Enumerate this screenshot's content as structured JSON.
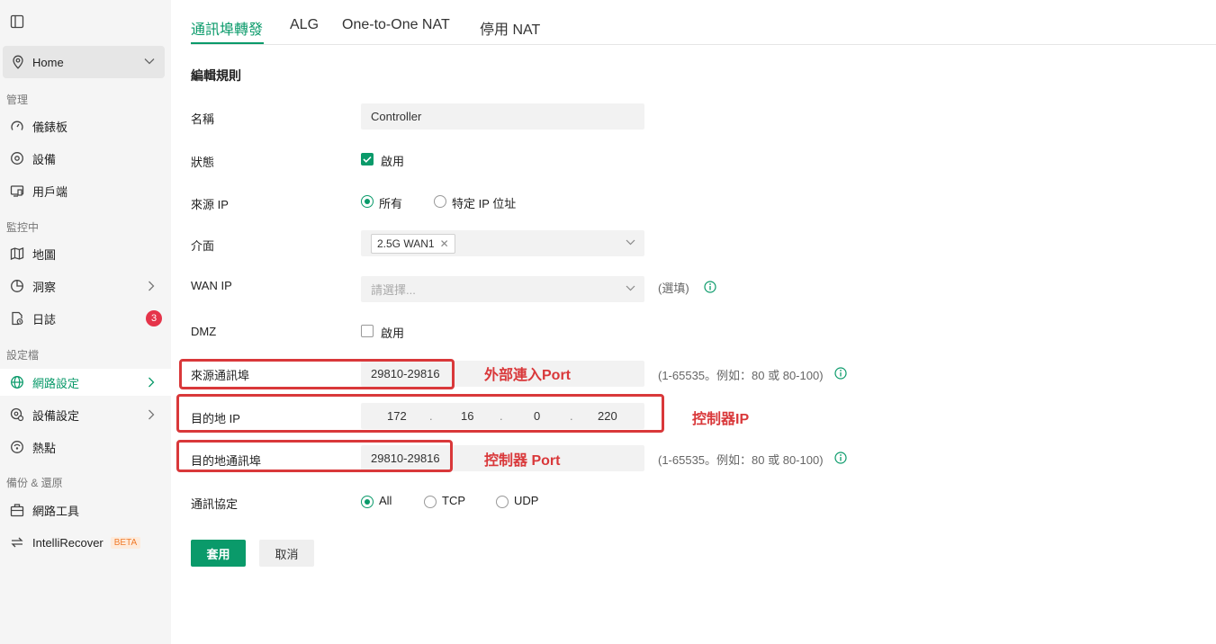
{
  "sidebar": {
    "site": "Home",
    "sections": {
      "manage": "管理",
      "monitor": "監控中",
      "profiles": "設定檔",
      "backup": "備份 & 還原"
    },
    "items": {
      "dashboard": "儀錶板",
      "devices": "設備",
      "clients": "用戶端",
      "map": "地圖",
      "insights": "洞察",
      "logs": "日誌",
      "logs_badge": "3",
      "network_settings": "網路設定",
      "device_settings": "設備設定",
      "hotspot": "熱點",
      "network_tools": "網路工具",
      "intellirecover": "IntelliRecover",
      "beta": "BETA"
    }
  },
  "tabs": [
    "通訊埠轉發",
    "ALG",
    "One-to-One NAT",
    "停用 NAT"
  ],
  "form": {
    "title": "編輯規則",
    "name_label": "名稱",
    "name_value": "Controller",
    "status_label": "狀態",
    "status_option": "啟用",
    "source_ip_label": "來源 IP",
    "source_ip_all": "所有",
    "source_ip_specific": "特定 IP 位址",
    "interface_label": "介面",
    "interface_chip": "2.5G WAN1",
    "wan_ip_label": "WAN IP",
    "wan_ip_placeholder": "請選擇...",
    "wan_ip_hint": "(選填)",
    "dmz_label": "DMZ",
    "dmz_option": "啟用",
    "source_port_label": "來源通訊埠",
    "source_port_value": "29810-29816",
    "port_hint": "(1-65535。例如：80 或 80-100)",
    "dest_ip_label": "目的地 IP",
    "dest_ip": [
      "172",
      "16",
      "0",
      "220"
    ],
    "dest_port_label": "目的地通訊埠",
    "dest_port_value": "29810-29816",
    "protocol_label": "通訊協定",
    "protocols": [
      "All",
      "TCP",
      "UDP"
    ],
    "apply": "套用",
    "cancel": "取消"
  },
  "annotations": {
    "source_port_note": "外部連入Port",
    "dest_ip_note": "控制器IP",
    "dest_port_note": "控制器 Port"
  },
  "colors": {
    "accent": "#0a9a6a",
    "callout": "#d9383a",
    "badge": "#e5344a"
  }
}
